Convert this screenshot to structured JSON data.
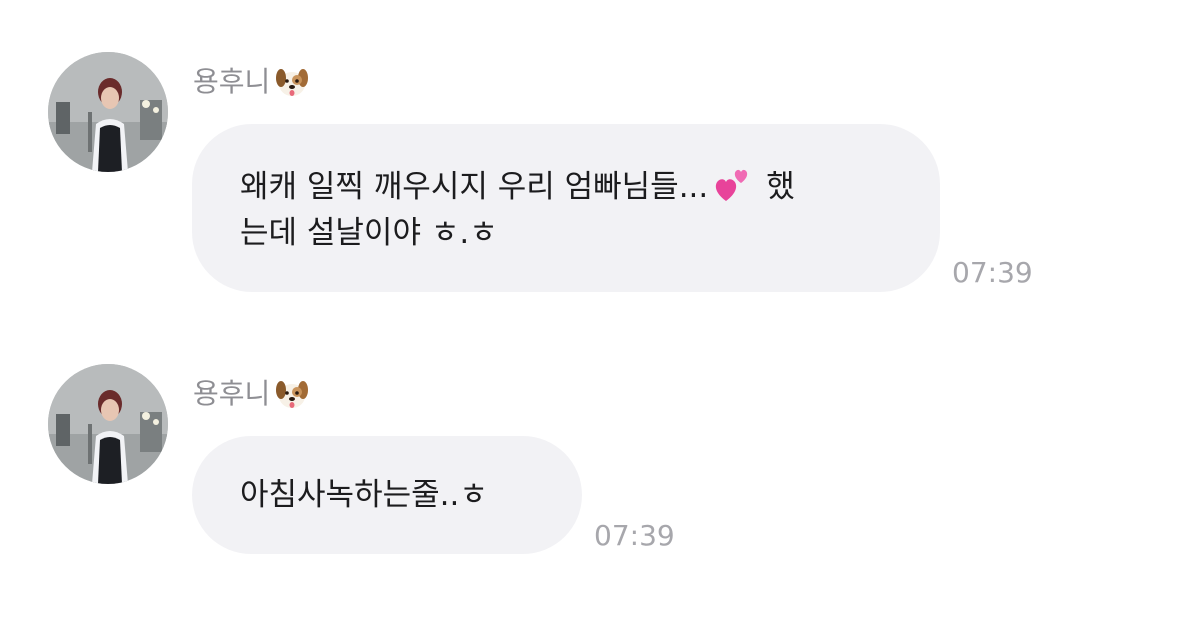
{
  "messages": [
    {
      "sender": "용후니",
      "sender_emoji": "dog-face",
      "text_line1_before": "왜캐 일찍 깨우시지 우리 엄빠님들...",
      "text_line1_emoji": "two-hearts",
      "text_line1_after": "했",
      "text_line2": "는데 설날이야 ㅎ.ㅎ",
      "time": "07:39"
    },
    {
      "sender": "용후니",
      "sender_emoji": "dog-face",
      "text": "아침사녹하는줄..ㅎ",
      "time": "07:39"
    }
  ],
  "colors": {
    "bubble": "#f2f2f5",
    "sender_name": "#8e8e93",
    "timestamp": "#a7a7ac",
    "text": "#1c1c1e"
  }
}
